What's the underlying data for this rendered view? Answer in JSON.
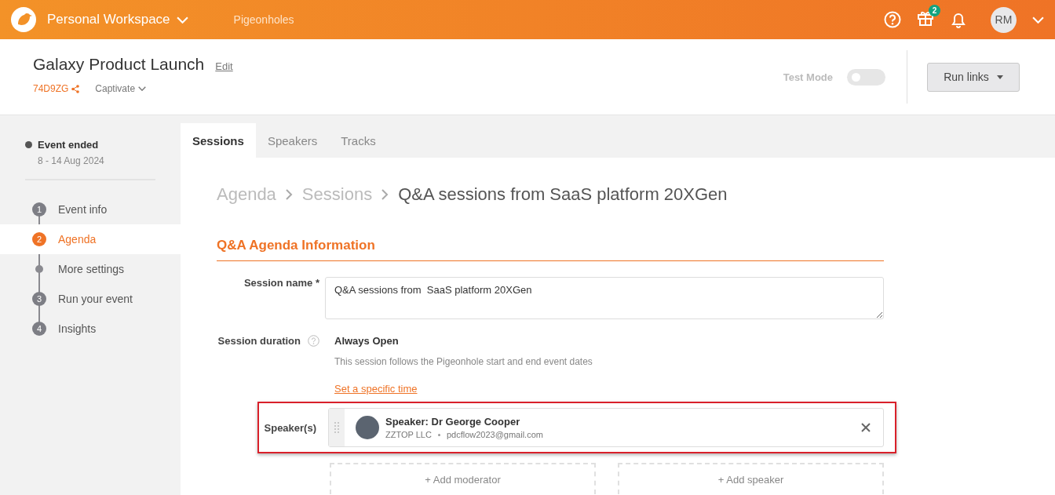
{
  "topbar": {
    "workspace": "Personal Workspace",
    "nav_link": "Pigeonholes",
    "gift_badge": "2",
    "avatar_initials": "RM"
  },
  "event": {
    "title": "Galaxy Product Launch",
    "edit_link": "Edit",
    "code": "74D9ZG",
    "plan": "Captivate",
    "test_mode": {
      "label": "Test Mode",
      "on": false
    },
    "run_button": "Run links"
  },
  "sidebar": {
    "status": "Event ended",
    "dates": "8 - 14 Aug 2024",
    "steps": [
      {
        "kind": "number",
        "number": "1",
        "label": "Event info",
        "selected": false
      },
      {
        "kind": "number",
        "number": "2",
        "label": "Agenda",
        "selected": true
      },
      {
        "kind": "dot",
        "label": "More settings",
        "selected": false
      },
      {
        "kind": "number",
        "number": "3",
        "label": "Run your event",
        "selected": false
      },
      {
        "kind": "number",
        "number": "4",
        "label": "Insights",
        "selected": false
      }
    ]
  },
  "tabs": [
    {
      "label": "Sessions",
      "selected": true
    },
    {
      "label": "Speakers",
      "selected": false
    },
    {
      "label": "Tracks",
      "selected": false
    }
  ],
  "breadcrumb": [
    "Agenda",
    "Sessions",
    "Q&A sessions from SaaS platform 20XGen"
  ],
  "form": {
    "section_title": "Q&A Agenda Information",
    "session_name_label": "Session name *",
    "session_name_value": "Q&A sessions from  SaaS platform 20XGen",
    "duration_label": "Session duration",
    "duration_value": "Always Open",
    "duration_hint": "This session follows the Pigeonhole start and end event dates",
    "set_time_link": "Set a specific time",
    "speakers_label": "Speaker(s)",
    "speakers": [
      {
        "name": "Speaker: Dr George Cooper",
        "company": "ZZTOP LLC",
        "email": "pdcflow2023@gmail.com"
      }
    ],
    "add_moderator": "+ Add moderator",
    "add_speaker": "+ Add speaker"
  }
}
